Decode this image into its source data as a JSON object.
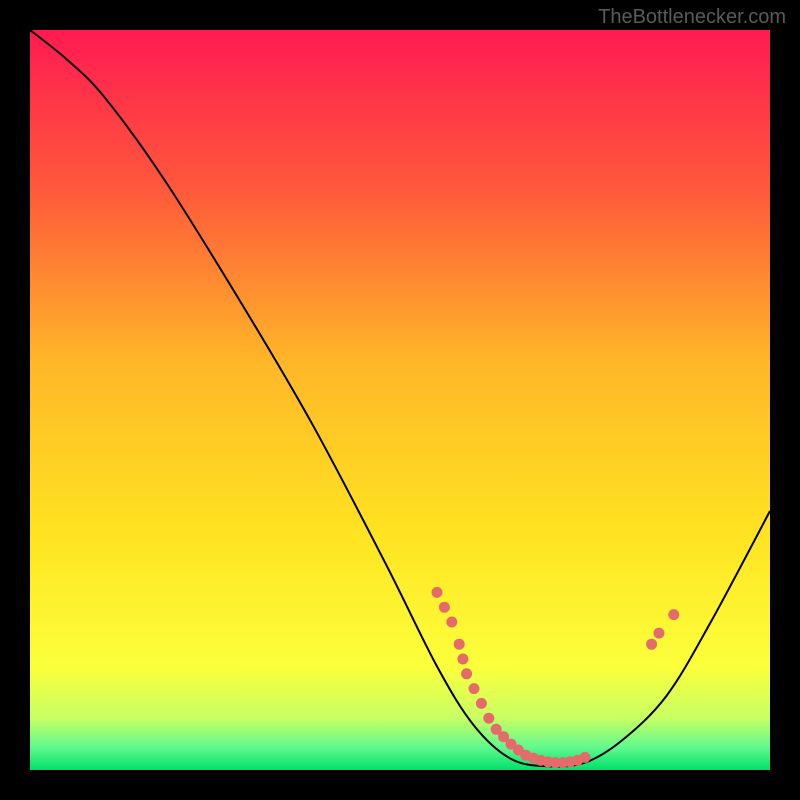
{
  "watermark": "TheBottleneсker.com",
  "chart_data": {
    "type": "line",
    "title": "",
    "xlabel": "",
    "ylabel": "",
    "xlim": [
      0,
      100
    ],
    "ylim": [
      0,
      100
    ],
    "gradient_stops": [
      {
        "offset": 0,
        "color": "#ff1a52"
      },
      {
        "offset": 0.22,
        "color": "#ff5a3a"
      },
      {
        "offset": 0.45,
        "color": "#ffb728"
      },
      {
        "offset": 0.68,
        "color": "#ffe321"
      },
      {
        "offset": 0.86,
        "color": "#fcff3b"
      },
      {
        "offset": 0.93,
        "color": "#c7ff63"
      },
      {
        "offset": 0.97,
        "color": "#60f98e"
      },
      {
        "offset": 1.0,
        "color": "#00e06a"
      }
    ],
    "curve": [
      {
        "x": 0,
        "y": 100
      },
      {
        "x": 5,
        "y": 96
      },
      {
        "x": 10,
        "y": 91
      },
      {
        "x": 18,
        "y": 80
      },
      {
        "x": 28,
        "y": 64
      },
      {
        "x": 38,
        "y": 47
      },
      {
        "x": 48,
        "y": 28
      },
      {
        "x": 55,
        "y": 14
      },
      {
        "x": 60,
        "y": 6
      },
      {
        "x": 65,
        "y": 1.5
      },
      {
        "x": 70,
        "y": 0.5
      },
      {
        "x": 75,
        "y": 1
      },
      {
        "x": 80,
        "y": 4
      },
      {
        "x": 86,
        "y": 10
      },
      {
        "x": 92,
        "y": 20
      },
      {
        "x": 100,
        "y": 35
      }
    ],
    "markers": [
      {
        "x": 55,
        "y": 24
      },
      {
        "x": 56,
        "y": 22
      },
      {
        "x": 57,
        "y": 20
      },
      {
        "x": 58,
        "y": 17
      },
      {
        "x": 58.5,
        "y": 15
      },
      {
        "x": 59,
        "y": 13
      },
      {
        "x": 60,
        "y": 11
      },
      {
        "x": 61,
        "y": 9
      },
      {
        "x": 62,
        "y": 7
      },
      {
        "x": 63,
        "y": 5.5
      },
      {
        "x": 64,
        "y": 4.5
      },
      {
        "x": 65,
        "y": 3.5
      },
      {
        "x": 66,
        "y": 2.7
      },
      {
        "x": 67,
        "y": 2.0
      },
      {
        "x": 68,
        "y": 1.6
      },
      {
        "x": 69,
        "y": 1.3
      },
      {
        "x": 70,
        "y": 1.1
      },
      {
        "x": 71,
        "y": 1.0
      },
      {
        "x": 72,
        "y": 1.0
      },
      {
        "x": 73,
        "y": 1.1
      },
      {
        "x": 74,
        "y": 1.3
      },
      {
        "x": 75,
        "y": 1.7
      },
      {
        "x": 84,
        "y": 17
      },
      {
        "x": 85,
        "y": 18.5
      },
      {
        "x": 87,
        "y": 21
      }
    ],
    "marker_color": "#e56a6a",
    "curve_color": "#000000"
  }
}
